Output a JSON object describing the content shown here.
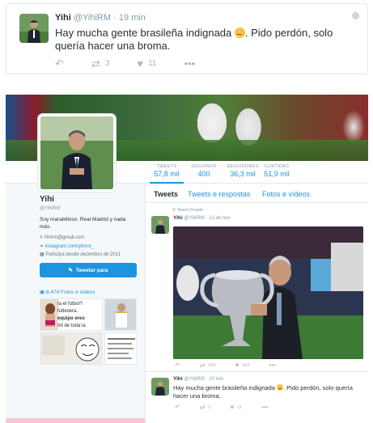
{
  "top_tweet": {
    "name": "Yihi",
    "handle": "@YihiRM",
    "time": "· 19 min",
    "text_before": "Hay mucha gente brasileña indignada",
    "text_after": ". Pido perdón, solo quería hacer una broma.",
    "retweets": "3",
    "likes": "11"
  },
  "stats": [
    {
      "label": "TWEETS",
      "value": "57,8 mil"
    },
    {
      "label": "SEGUINDO",
      "value": "400"
    },
    {
      "label": "SEGUIDORES",
      "value": "36,3 mil"
    },
    {
      "label": "CURTIDAS",
      "value": "51,9 mil"
    }
  ],
  "profile": {
    "name": "Yihi",
    "handle": "@YihiRM",
    "bio": "Soy marabilloso. Real Madrid y nada más.",
    "email": "Yihirm@gmail.com",
    "link": "instagram.com/yihirm_",
    "joined": "Participa desde dezembro de 2011",
    "tweet_to": "Tweetar para",
    "media": "6.474 Fotos e vídeos"
  },
  "thumbs": {
    "t1_line1": "ta el fútbol?",
    "t1_line2": "futbolera.",
    "t1_line3": "equipo eres",
    "t1_line4": "rid de toda la"
  },
  "tabs": [
    "Tweets",
    "Tweets e respostas",
    "Fotos e vídeos"
  ],
  "pinned": {
    "label": "Tweet Fixado",
    "name": "Yihi",
    "handle": "@YihiRM",
    "time": "· 21 de nov",
    "retweets": "463",
    "likes": "363"
  },
  "second_tweet": {
    "name": "Yihi",
    "handle": "@YihiRM",
    "time": "· 10 min",
    "text_before": "Hay mucha gente brasileña indignada",
    "text_after": ". Pido perdón, solo quería hacer una broma.",
    "retweets": "3",
    "likes": "11"
  },
  "colors": {
    "accent": "#1b95e0",
    "muted": "#8899a6",
    "text": "#292f33",
    "panel": "#f5f8fa"
  }
}
